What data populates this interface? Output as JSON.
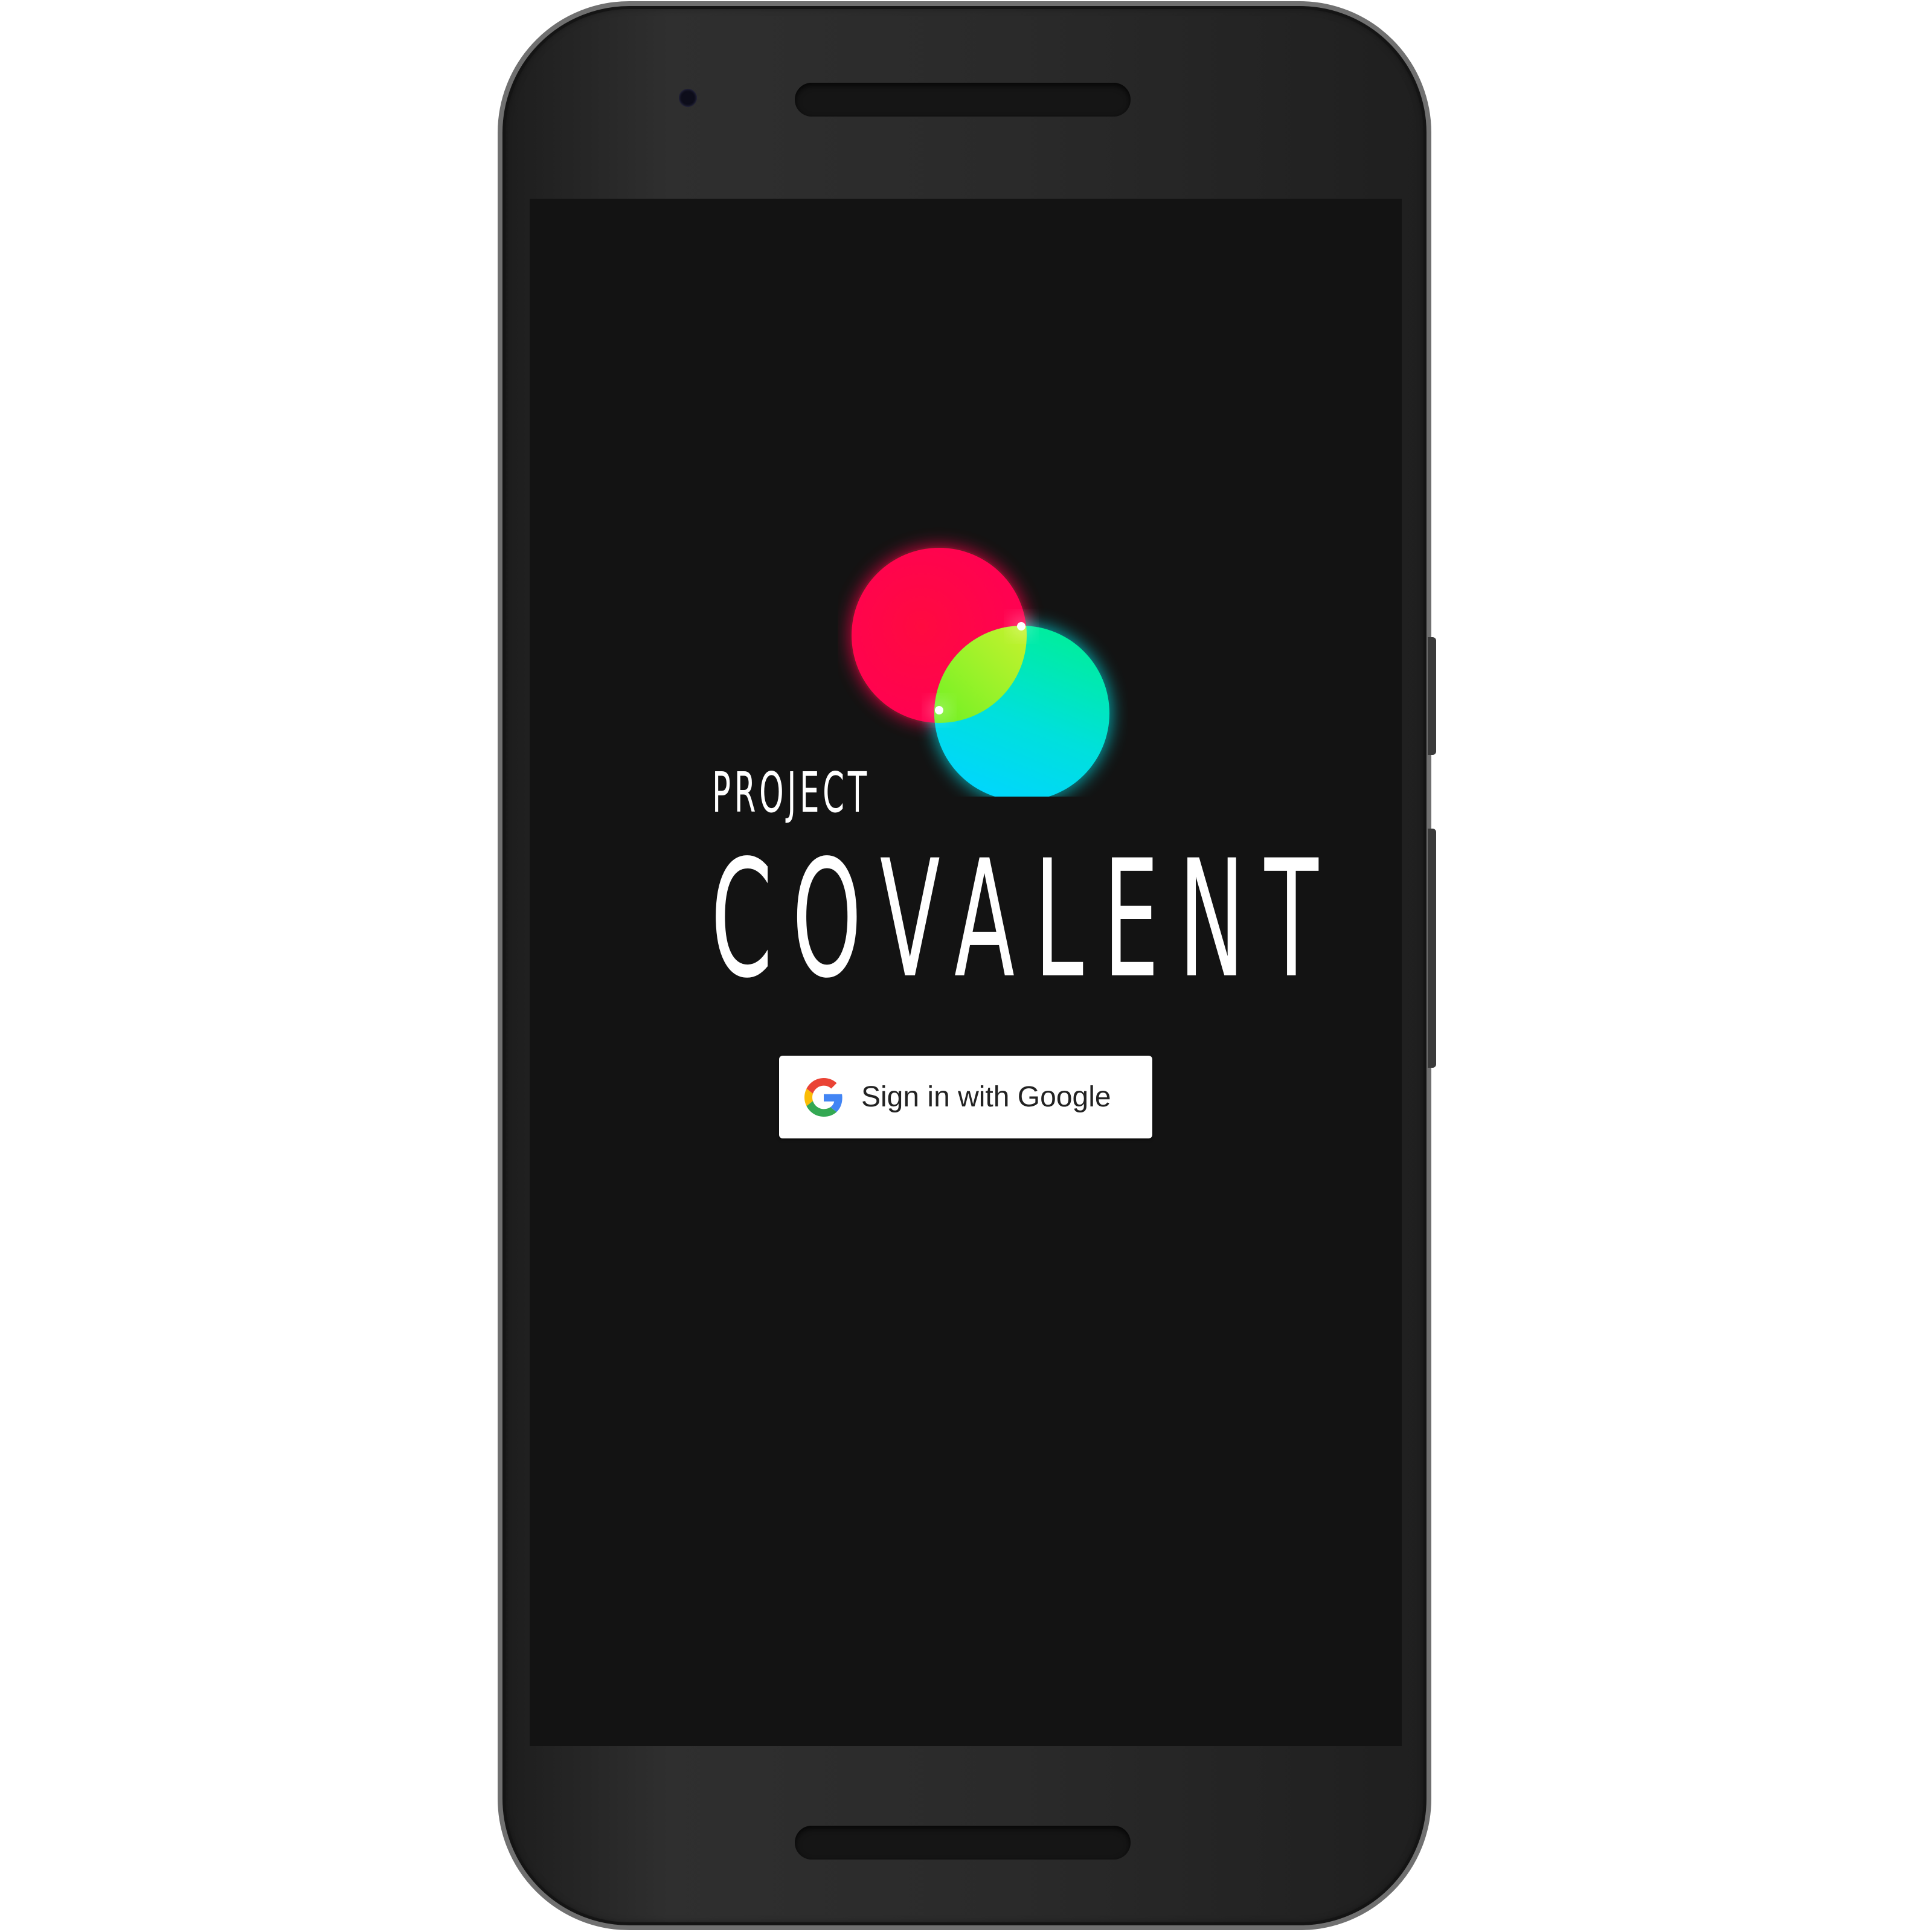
{
  "app": {
    "wordmark_prefix": "PROJECT",
    "wordmark_name": "COVALENT",
    "logo_icon": "overlapping-circles-logo"
  },
  "login": {
    "google_button_label": "Sign in with Google",
    "google_icon": "google-g-icon"
  },
  "colors": {
    "screen_background": "#131313",
    "logo_red": "#ff0a4a",
    "logo_cyan": "#00dcff",
    "logo_overlap": "#a8ff3a",
    "button_background": "#ffffff"
  }
}
